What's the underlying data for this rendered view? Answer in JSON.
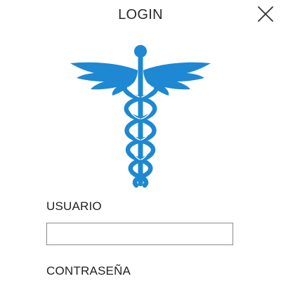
{
  "header": {
    "title": "LOGIN",
    "close_icon": "close-icon"
  },
  "logo": {
    "icon": "caduceus-icon",
    "color": "#1E88D2"
  },
  "form": {
    "username_label": "USUARIO",
    "username_value": "",
    "password_label": "CONTRASEÑA"
  }
}
